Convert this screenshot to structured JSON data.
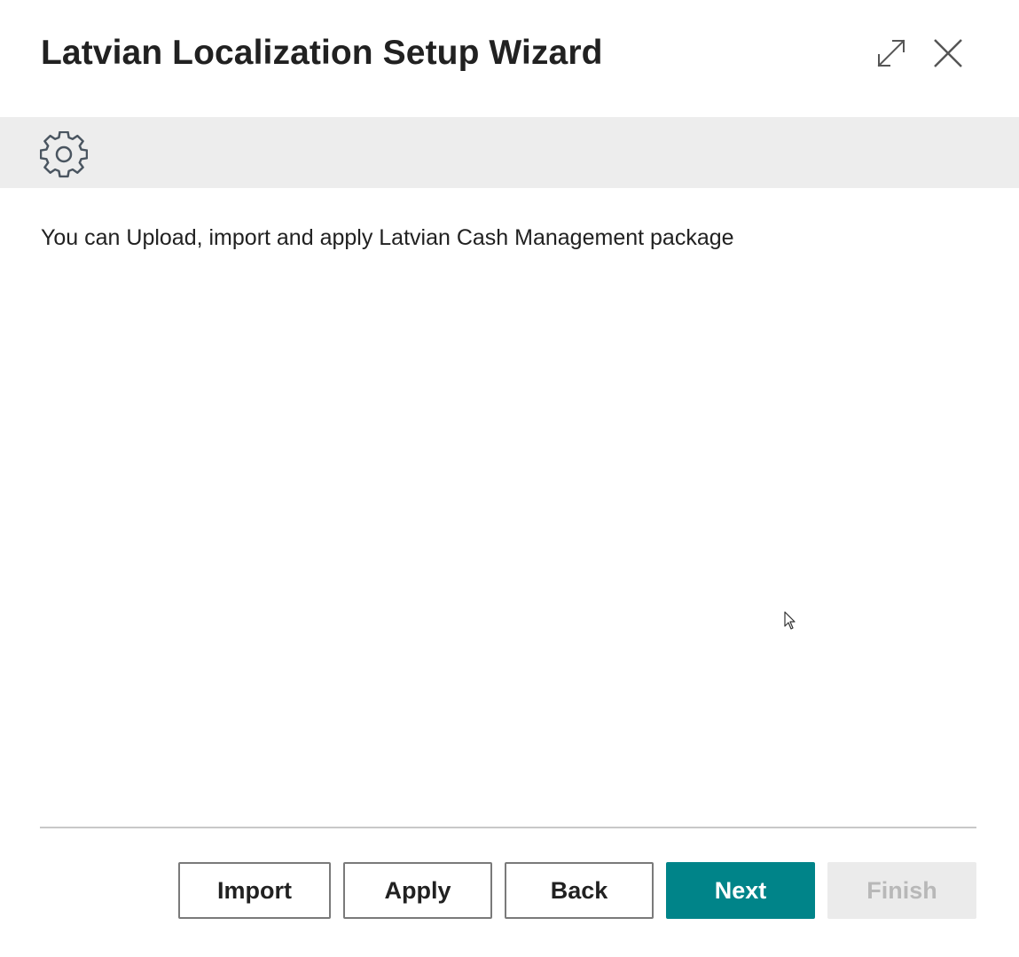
{
  "dialog": {
    "title": "Latvian Localization Setup Wizard",
    "expand_icon": "expand-icon",
    "close_icon": "close-icon"
  },
  "banner": {
    "icon": "gear-icon",
    "background": "#ededed"
  },
  "content": {
    "instruction": "You can Upload, import and apply Latvian Cash Management package"
  },
  "footer": {
    "buttons": {
      "import_label": "Import",
      "apply_label": "Apply",
      "back_label": "Back",
      "next_label": "Next",
      "finish_label": "Finish"
    }
  },
  "colors": {
    "accent": "#008489",
    "disabled_bg": "#ebebeb",
    "disabled_text": "#b8b8b8"
  }
}
